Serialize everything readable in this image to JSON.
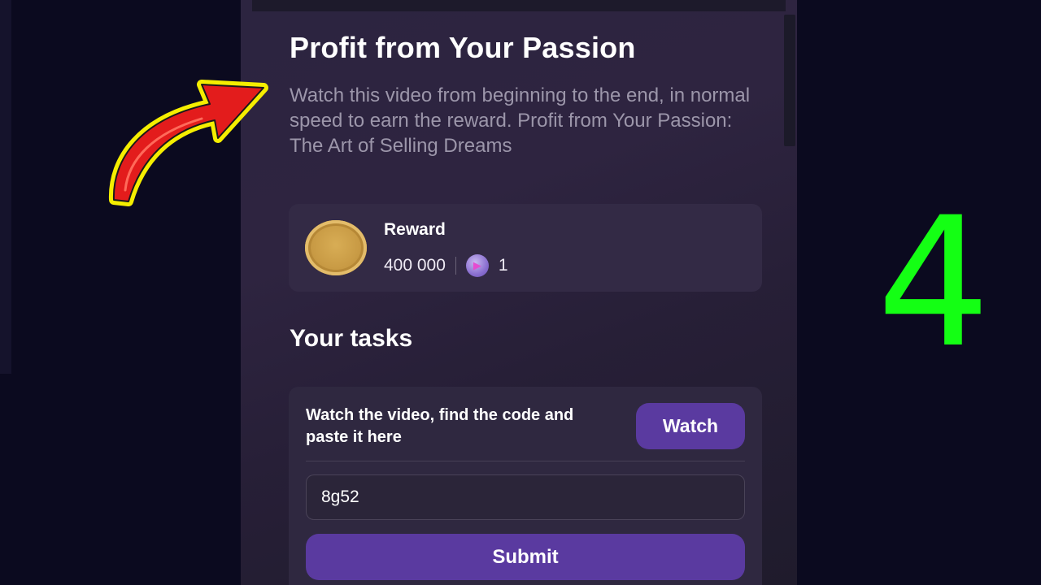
{
  "header": {
    "title": "Profit from Your Passion",
    "description": "Watch this video from beginning to the end, in normal speed to earn the reward. Profit from Your Passion: The Art of Selling Dreams"
  },
  "reward": {
    "label": "Reward",
    "amount": "400 000",
    "separator": "|",
    "count": "1"
  },
  "tasks": {
    "heading": "Your tasks",
    "instruction": "Watch the video, find the code and paste it here",
    "watch_label": "Watch",
    "code_value": "8g52",
    "submit_label": "Submit"
  },
  "overlay": {
    "number": "4",
    "number_color": "#14ff14",
    "arrow_fill": "#e31c1c",
    "arrow_outline": "#f5ee00"
  },
  "colors": {
    "accent": "#5a3aa0",
    "background": "#0b0a1f"
  }
}
